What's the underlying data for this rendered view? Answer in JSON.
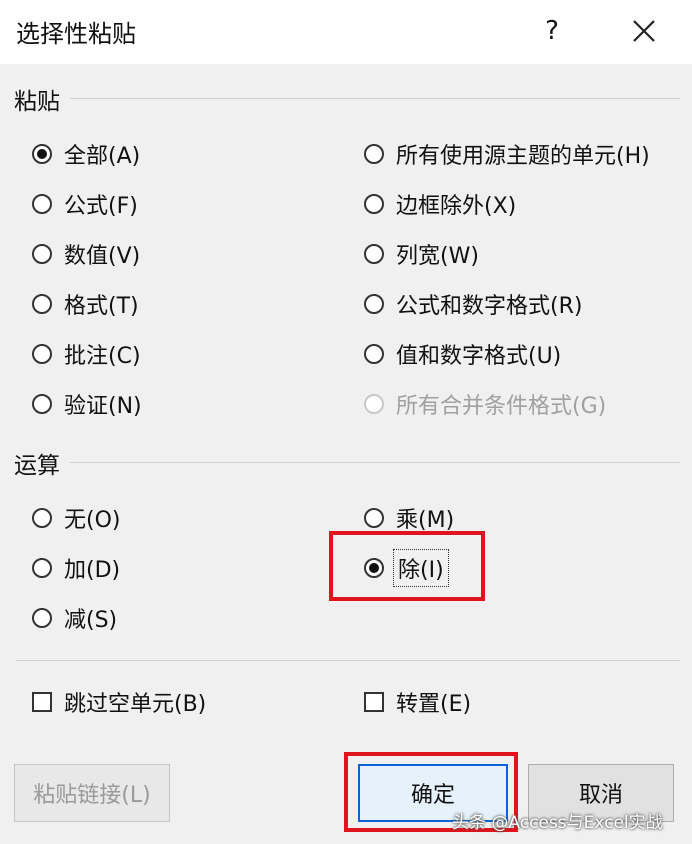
{
  "dialog": {
    "title": "选择性粘贴",
    "help": "?",
    "close_icon": "close-icon"
  },
  "paste_group": {
    "label": "粘贴",
    "options": [
      {
        "label": "全部(A)",
        "checked": true
      },
      {
        "label": "公式(F)"
      },
      {
        "label": "数值(V)"
      },
      {
        "label": "格式(T)"
      },
      {
        "label": "批注(C)"
      },
      {
        "label": "验证(N)"
      },
      {
        "label": "所有使用源主题的单元(H)"
      },
      {
        "label": "边框除外(X)"
      },
      {
        "label": "列宽(W)"
      },
      {
        "label": "公式和数字格式(R)"
      },
      {
        "label": "值和数字格式(U)"
      },
      {
        "label": "所有合并条件格式(G)",
        "disabled": true
      }
    ]
  },
  "operation_group": {
    "label": "运算",
    "options": [
      {
        "label": "无(O)"
      },
      {
        "label": "加(D)"
      },
      {
        "label": "减(S)"
      },
      {
        "label": "乘(M)"
      },
      {
        "label": "除(I)",
        "checked": true
      }
    ]
  },
  "checkboxes": {
    "skip_blanks": "跳过空单元(B)",
    "transpose": "转置(E)"
  },
  "buttons": {
    "paste_link": "粘贴链接(L)",
    "ok": "确定",
    "cancel": "取消"
  },
  "watermark": "头条 @Access与Excel实战",
  "colors": {
    "highlight": "#e0141c",
    "default_button_border": "#0a64d6"
  }
}
